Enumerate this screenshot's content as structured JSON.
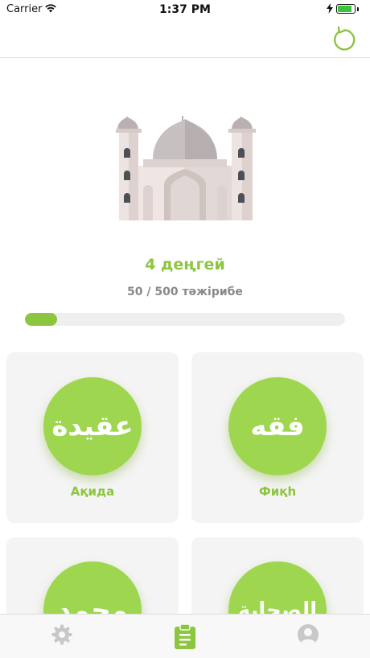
{
  "status_bar": {
    "carrier": "Carrier",
    "time": "1:37 PM"
  },
  "header": {
    "reset_icon": "refresh-icon"
  },
  "level": {
    "title": "4 деңгей",
    "xp_text": "50 / 500 тәжірибе",
    "progress": 0.1
  },
  "categories": [
    {
      "arabic": "عقيدة",
      "label": "Ақида"
    },
    {
      "arabic": "فقه",
      "label": "Фиқһ"
    },
    {
      "arabic": "محمد",
      "label": ""
    },
    {
      "arabic": "الصحابة",
      "label": ""
    }
  ],
  "tabs": [
    {
      "icon": "gear-icon",
      "active": false
    },
    {
      "icon": "clipboard-icon",
      "active": true
    },
    {
      "icon": "profile-icon",
      "active": false
    }
  ],
  "colors": {
    "accent": "#8cc63f",
    "circle": "#9fd64f",
    "inactive_icon": "#c8c8c8"
  }
}
